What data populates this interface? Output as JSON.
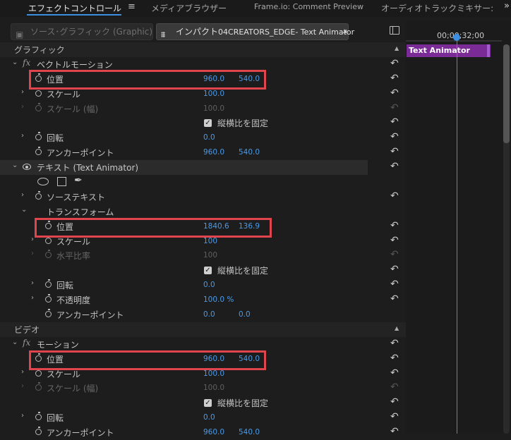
{
  "tabs": {
    "effect_controls": "エフェクトコントロール",
    "menu_glyph": "≡",
    "media_browser": "メディアブラウザー",
    "comment": "Frame.io: Comment Preview",
    "audio_mixer": "オーディオトラックミキサー: テ",
    "more": "»"
  },
  "source": {
    "source_label": "ソース･グラフィック (Graphic)",
    "active_prefix": "インパクト",
    "active_rest": "04CREATORS_EDGE- Text Animator"
  },
  "sections": {
    "graphic": "グラフィック",
    "video": "ビデオ"
  },
  "vector_motion": {
    "name": "ベクトルモーション",
    "position": {
      "label": "位置",
      "x": "960.0",
      "y": "540.0"
    },
    "scale": {
      "label": "スケール",
      "value": "100.0"
    },
    "scale_width": {
      "label": "スケール (幅)",
      "value": "100.0"
    },
    "uniform": "縦横比を固定",
    "rotation": {
      "label": "回転",
      "value": "0.0"
    },
    "anchor": {
      "label": "アンカーポイント",
      "x": "960.0",
      "y": "540.0"
    }
  },
  "text_layer": {
    "name": "テキスト (Text Animator)",
    "source_text": "ソーステキスト",
    "transform": "トランスフォーム",
    "position": {
      "label": "位置",
      "x": "1840.6",
      "y": "136.9"
    },
    "scale": {
      "label": "スケール",
      "value": "100"
    },
    "horizontal_ratio": {
      "label": "水平比率",
      "value": "100"
    },
    "uniform": "縦横比を固定",
    "rotation": {
      "label": "回転",
      "value": "0.0"
    },
    "opacity": {
      "label": "不透明度",
      "value": "100.0 %"
    },
    "anchor": {
      "label": "アンカーポイント",
      "x": "0.0",
      "y": "0.0"
    }
  },
  "motion": {
    "name": "モーション",
    "position": {
      "label": "位置",
      "x": "960.0",
      "y": "540.0"
    },
    "scale": {
      "label": "スケール",
      "value": "100.0"
    },
    "scale_width": {
      "label": "スケール (幅)",
      "value": "100.0"
    },
    "uniform": "縦横比を固定",
    "rotation": {
      "label": "回転",
      "value": "0.0"
    },
    "anchor": {
      "label": "アンカーポイント",
      "x": "960.0",
      "y": "540.0"
    }
  },
  "timeline": {
    "timecode": "00;00;32;00",
    "clip_label": "Text Animator"
  },
  "colors": {
    "accent_blue": "#3b8ee0",
    "value_blue": "#4a9ae8",
    "highlight_red": "#e0454d",
    "clip_purple": "#7b2b96"
  }
}
